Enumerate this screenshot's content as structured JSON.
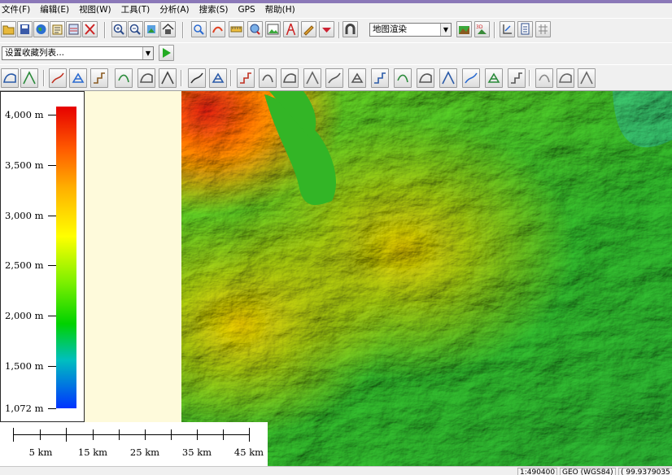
{
  "menu": [
    "文件(F)",
    "编辑(E)",
    "视图(W)",
    "工具(T)",
    "分析(A)",
    "搜索(S)",
    "GPS",
    "帮助(H)"
  ],
  "toolbar": {
    "render_combo": "地图渲染",
    "favorites_combo": "设置收藏列表..."
  },
  "legend": {
    "labels": [
      "4,000 m",
      "3,500 m",
      "3,000 m",
      "2,500 m",
      "2,000 m",
      "1,500 m",
      "1,072 m"
    ],
    "colors": [
      "#e60000",
      "#ffb000",
      "#ffff00",
      "#00d200",
      "#00bfbf",
      "#0033ff"
    ]
  },
  "scale_bar": {
    "labels": [
      "5 km",
      "15 km",
      "25 km",
      "35 km",
      "45 km"
    ]
  },
  "statusbar": {
    "scale": "1:490400",
    "crs": "GEO (WGS84)",
    "coords": "( 99.9379035"
  },
  "icons": [
    "open-icon",
    "save-icon",
    "globe-icon",
    "print-icon",
    "layers-icon",
    "tools-icon",
    "zoom-in-icon",
    "zoom-out-icon",
    "zoom-layer-icon",
    "home-icon",
    "pan-icon",
    "measure-icon",
    "ruler-icon",
    "search-icon",
    "image-icon",
    "tower-icon",
    "edit-icon",
    "dropdown-icon",
    "magnet-icon",
    "3d-icon",
    "export-icon",
    "doc-icon",
    "grid-icon",
    "play-icon"
  ]
}
